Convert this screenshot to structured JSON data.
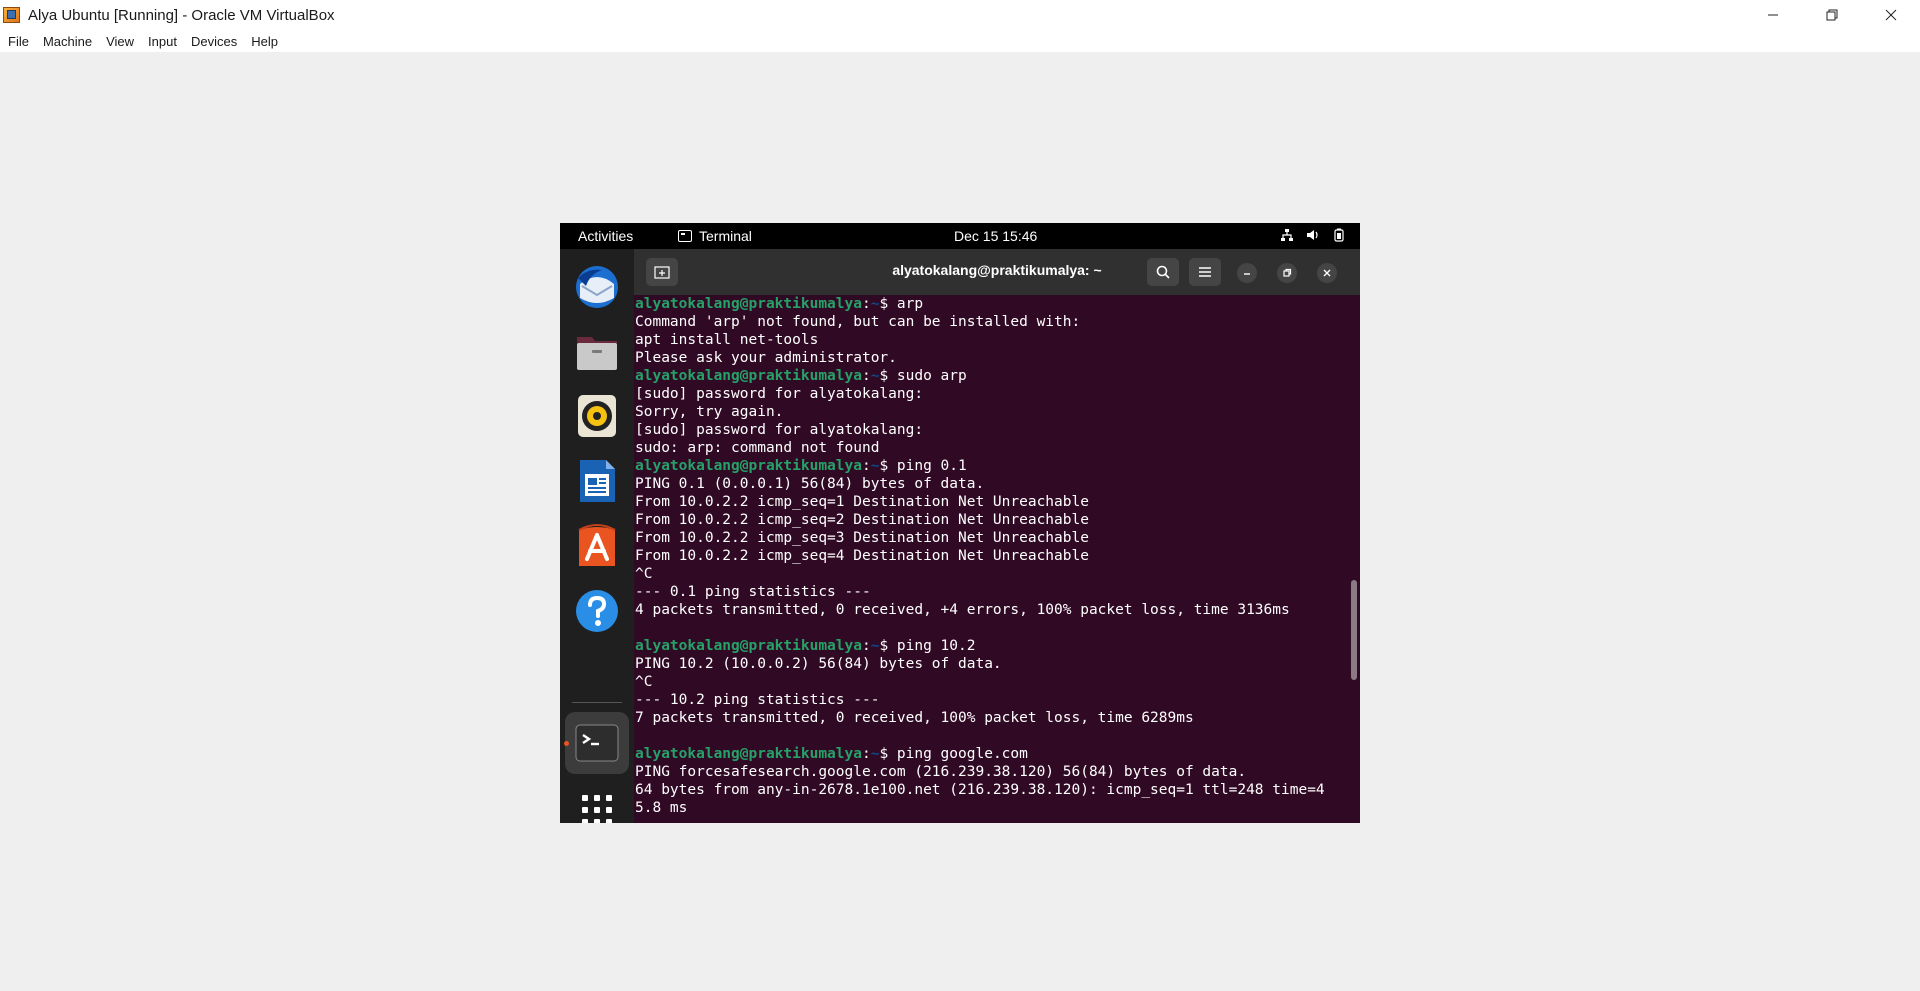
{
  "window": {
    "title": "Alya Ubuntu [Running] - Oracle VM VirtualBox",
    "controls": [
      "minimize-icon",
      "restore-icon",
      "close-icon"
    ]
  },
  "menubar": {
    "items": [
      {
        "label": "File"
      },
      {
        "label": "Machine"
      },
      {
        "label": "View"
      },
      {
        "label": "Input"
      },
      {
        "label": "Devices"
      },
      {
        "label": "Help"
      }
    ]
  },
  "ubuntu_topbar": {
    "activities": "Activities",
    "app_name": "Terminal",
    "clock": "Dec 15  15:46",
    "tray_icons": [
      "network-icon",
      "volume-icon",
      "battery-icon"
    ]
  },
  "dock": {
    "items": [
      "thunderbird-icon",
      "files-icon",
      "rhythmbox-icon",
      "writer-icon",
      "app-center-icon",
      "help-icon",
      "terminal-icon",
      "show-apps-icon"
    ],
    "colors": {
      "accent": "#e95420"
    }
  },
  "terminal": {
    "title": "alyatokalang@praktikumalya: ~",
    "colors": {
      "background": "#300a24",
      "prompt_user": "#26a269",
      "prompt_path": "#12488b",
      "text": "#ffffff"
    },
    "lines": [
      {
        "type": "prompt",
        "user": "alyatokalang@praktikumalya",
        "sep": ":",
        "path": "~",
        "cmd": "$ arp"
      },
      {
        "type": "out",
        "text": "Command 'arp' not found, but can be installed with:"
      },
      {
        "type": "out",
        "text": "apt install net-tools"
      },
      {
        "type": "out",
        "text": "Please ask your administrator."
      },
      {
        "type": "prompt",
        "user": "alyatokalang@praktikumalya",
        "sep": ":",
        "path": "~",
        "cmd": "$ sudo arp"
      },
      {
        "type": "out",
        "text": "[sudo] password for alyatokalang:"
      },
      {
        "type": "out",
        "text": "Sorry, try again."
      },
      {
        "type": "out",
        "text": "[sudo] password for alyatokalang:"
      },
      {
        "type": "out",
        "text": "sudo: arp: command not found"
      },
      {
        "type": "prompt",
        "user": "alyatokalang@praktikumalya",
        "sep": ":",
        "path": "~",
        "cmd": "$ ping 0.1"
      },
      {
        "type": "out",
        "text": "PING 0.1 (0.0.0.1) 56(84) bytes of data."
      },
      {
        "type": "out",
        "text": "From 10.0.2.2 icmp_seq=1 Destination Net Unreachable"
      },
      {
        "type": "out",
        "text": "From 10.0.2.2 icmp_seq=2 Destination Net Unreachable"
      },
      {
        "type": "out",
        "text": "From 10.0.2.2 icmp_seq=3 Destination Net Unreachable"
      },
      {
        "type": "out",
        "text": "From 10.0.2.2 icmp_seq=4 Destination Net Unreachable"
      },
      {
        "type": "out",
        "text": "^C"
      },
      {
        "type": "out",
        "text": "--- 0.1 ping statistics ---"
      },
      {
        "type": "out",
        "text": "4 packets transmitted, 0 received, +4 errors, 100% packet loss, time 3136ms"
      },
      {
        "type": "out",
        "text": ""
      },
      {
        "type": "prompt",
        "user": "alyatokalang@praktikumalya",
        "sep": ":",
        "path": "~",
        "cmd": "$ ping 10.2"
      },
      {
        "type": "out",
        "text": "PING 10.2 (10.0.0.2) 56(84) bytes of data."
      },
      {
        "type": "out",
        "text": "^C"
      },
      {
        "type": "out",
        "text": "--- 10.2 ping statistics ---"
      },
      {
        "type": "out",
        "text": "7 packets transmitted, 0 received, 100% packet loss, time 6289ms"
      },
      {
        "type": "out",
        "text": ""
      },
      {
        "type": "prompt",
        "user": "alyatokalang@praktikumalya",
        "sep": ":",
        "path": "~",
        "cmd": "$ ping google.com"
      },
      {
        "type": "out",
        "text": "PING forcesafesearch.google.com (216.239.38.120) 56(84) bytes of data."
      },
      {
        "type": "out",
        "text": "64 bytes from any-in-2678.1e100.net (216.239.38.120): icmp_seq=1 ttl=248 time=4"
      },
      {
        "type": "out",
        "text": "5.8 ms"
      }
    ]
  }
}
